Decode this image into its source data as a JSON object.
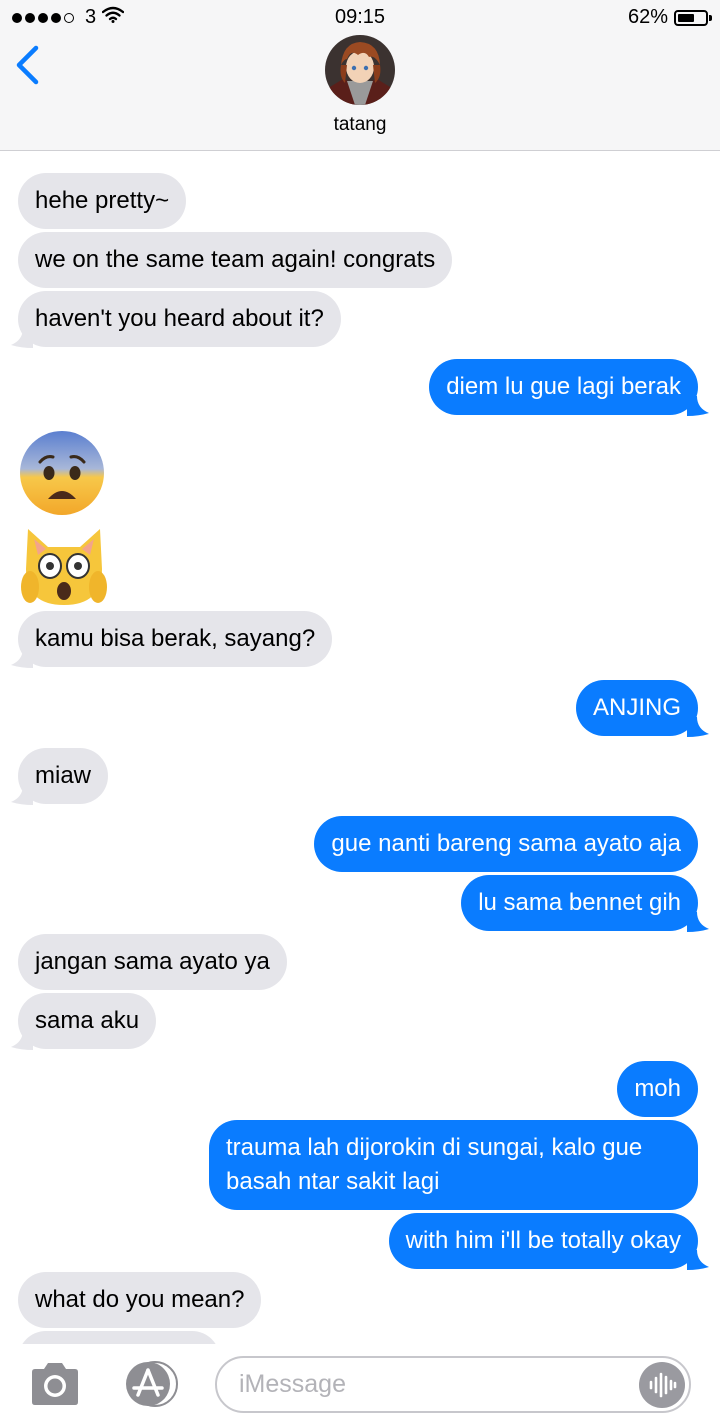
{
  "status_bar": {
    "carrier": "3",
    "time": "09:15",
    "battery": "62%",
    "battery_level": 0.62,
    "signal_bars": 4
  },
  "header": {
    "contact_name": "tatang",
    "back_icon": "chevron-left-icon"
  },
  "messages": [
    {
      "dir": "in",
      "text": "hehe pretty~"
    },
    {
      "dir": "in",
      "text": "we on the same team again! congrats"
    },
    {
      "dir": "in",
      "text": "haven't you heard about it?"
    },
    {
      "dir": "out",
      "text": "diem lu gue lagi berak"
    },
    {
      "dir": "in",
      "emoji": "😨"
    },
    {
      "dir": "in",
      "emoji": "🙀"
    },
    {
      "dir": "in",
      "text": "kamu bisa berak, sayang?"
    },
    {
      "dir": "out",
      "text": "ANJING"
    },
    {
      "dir": "in",
      "text": "miaw"
    },
    {
      "dir": "out",
      "text": "gue nanti bareng sama ayato aja"
    },
    {
      "dir": "out",
      "text": "lu sama bennet gih"
    },
    {
      "dir": "in",
      "text": "jangan sama ayato ya"
    },
    {
      "dir": "in",
      "text": "sama aku"
    },
    {
      "dir": "out",
      "text": "moh"
    },
    {
      "dir": "out",
      "text": "trauma lah dijorokin di sungai, kalo gue basah ntar sakit lagi"
    },
    {
      "dir": "out",
      "text": "with him i'll be totally okay"
    },
    {
      "dir": "in",
      "text": "what do you mean?"
    }
  ],
  "composer": {
    "placeholder": "iMessage",
    "value": "",
    "camera_icon": "camera-icon",
    "apps_icon": "app-store-icon",
    "audio_icon": "audio-waveform-icon"
  },
  "colors": {
    "incoming_bubble": "#e5e5ea",
    "outgoing_bubble": "#0a7cff",
    "accent": "#0a7cff",
    "header_bg": "#f6f6f7"
  }
}
